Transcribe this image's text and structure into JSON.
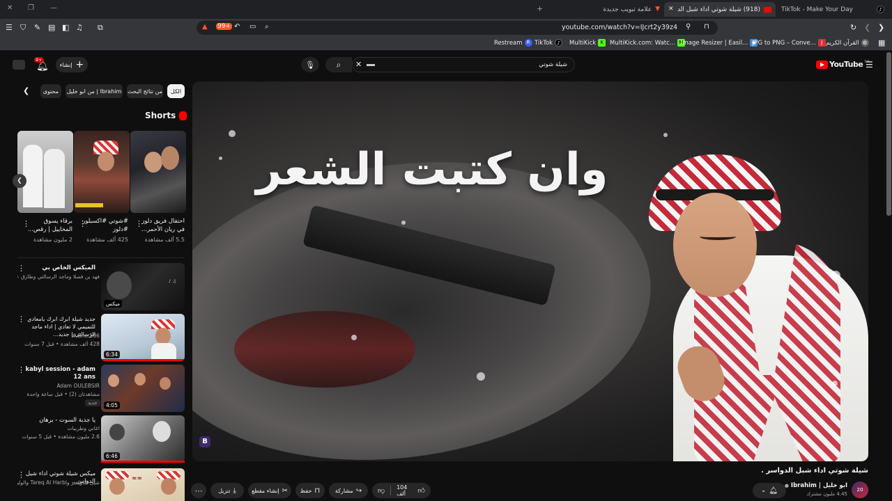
{
  "browser": {
    "tabs": [
      {
        "label": "TikTok - Make Your Day",
        "active": false
      },
      {
        "label": "(918) شيلة شوتي اداء شبل الدواس",
        "active": true
      },
      {
        "label": "علامة تبويب جديدة",
        "active": false
      }
    ],
    "url": "youtube.com/watch?v=IJcrt2y39z4",
    "shield_count": "99+",
    "bookmarks": [
      "Restream",
      "TikTok",
      "MultiKick",
      "MultiKick.com: Watc...",
      "Image Resizer | Easil...",
      "JPG to PNG – Conve...",
      "القرآن الكريم"
    ]
  },
  "youtube": {
    "logo": "YouTube",
    "region": "SA",
    "search_value": "شيلة شوتي",
    "create_label": "إنشاء",
    "notif_count": "9+",
    "chips": [
      "الكل",
      "من نتائج البحث",
      "من ابو خليل | Ibrahim",
      "محتوى"
    ],
    "shorts_title": "Shorts",
    "shorts": [
      {
        "title": "احتفال فريق دلوز في ريان الأحمر...",
        "views": "5.5 ألف مشاهدة"
      },
      {
        "title": "#شوتي #اكسبلور #دلوز",
        "views": "425 ألف مشاهدة"
      },
      {
        "title": "برقاء يسوق المخاييل | رقص...",
        "views": "2 مليون مشاهدة"
      }
    ],
    "recommended": [
      {
        "title": "الميكس الخاص بي",
        "meta1": "فهد بن فصلا وماجد الرسالتي وطارق عبدالله وطلال...",
        "meta2": "",
        "badge": "ميكس",
        "duration": ""
      },
      {
        "title": "جديد شيلة ابرك ابرك يامعادي للتميمي لا تعادي | اداء ماجد الرسالتي | جديد...",
        "meta1": "Bne.506 #",
        "meta2": "428 ألف مشاهدة • قبل 7 سنوات",
        "badge": "",
        "duration": "6:34"
      },
      {
        "title": "kabyl session - adam 12 ans",
        "meta1": "Adam OULEBSIR",
        "meta2": "مشاهدتان (2) • قبل ساعة واحدة",
        "badge": "جديد",
        "duration": "4:05"
      },
      {
        "title": "يا جذبة السوت - برهان",
        "meta1": "اغاني وطربيات",
        "meta2": "2.6 مليون مشاهدة • قبل 5 سنوات",
        "badge": "",
        "duration": "6:46"
      },
      {
        "title": "ميكس شيلة شوتي اداء شبل الدواس...",
        "meta1": "شبل الدواسر وTareq Al Harbi والوليد آل عا...",
        "meta2": "",
        "badge": "",
        "duration": ""
      }
    ],
    "video": {
      "overlay_text": "وان كتبت الشعر",
      "title": "شيلة شوتي اداء شبل الدواسر .",
      "channel_name": "ابو خليل | Ibrahim",
      "subscribers": "4.45 مليون مشترك",
      "likes": "104 ألف",
      "share_label": "مشاركة",
      "save_label": "حفظ",
      "clip_label": "إنشاء مقطع",
      "download_label": "تنزيل",
      "watermark": "B"
    },
    "colors": {
      "accent": "#ff0000",
      "background": "#0f0f0f",
      "chip": "#272727"
    }
  }
}
